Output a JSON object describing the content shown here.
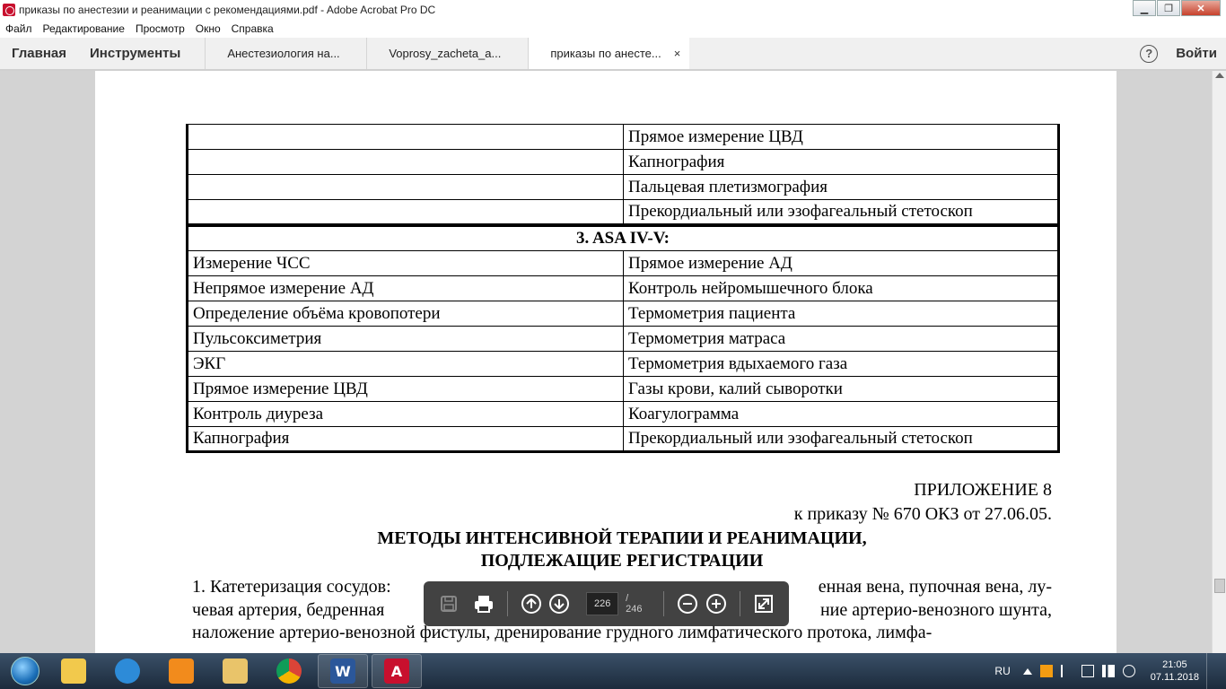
{
  "window": {
    "title": "приказы по анестезии и реанимации с рекомендациями.pdf - Adobe Acrobat Pro DC",
    "minimize": "▁",
    "maximize": "❐",
    "close": "✕"
  },
  "menu": [
    "Файл",
    "Редактирование",
    "Просмотр",
    "Окно",
    "Справка"
  ],
  "nav": {
    "home": "Главная",
    "tools": "Инструменты"
  },
  "tabs": [
    {
      "label": "Анестезиология на..."
    },
    {
      "label": "Voprosy_zacheta_a..."
    },
    {
      "label": "приказы по анесте...",
      "close": "×"
    }
  ],
  "header_right": {
    "help": "?",
    "signin": "Войти"
  },
  "table": {
    "top_rows": [
      [
        "",
        "Прямое измерение ЦВД"
      ],
      [
        "",
        "Капнография"
      ],
      [
        "",
        "Пальцевая плетизмография"
      ],
      [
        "",
        "Прекордиальный или эзофагеальный стетоскоп"
      ]
    ],
    "section_title": "3. ASA IV-V:",
    "rows": [
      [
        "Измерение ЧСС",
        "Прямое измерение АД"
      ],
      [
        "Непрямое измерение АД",
        "Контроль нейромышечного блока"
      ],
      [
        "Определение объёма кровопотери",
        "Термометрия пациента"
      ],
      [
        "Пульсоксиметрия",
        "Термометрия матраса"
      ],
      [
        "ЭКГ",
        "Термометрия вдыхаемого газа"
      ],
      [
        "Прямое измерение ЦВД",
        "Газы крови, калий сыворотки"
      ],
      [
        "Контроль диуреза",
        "Коагулограмма"
      ],
      [
        "Капнография",
        "Прекордиальный или эзофагеальный стетоскоп"
      ]
    ]
  },
  "appendix": {
    "line1": "ПРИЛОЖЕНИЕ 8",
    "line2": "к приказу № 670 ОКЗ от 27.06.05.",
    "title1": "МЕТОДЫ ИНТЕНСИВНОЙ ТЕРАПИИ И РЕАНИМАЦИИ,",
    "title2": "ПОДЛЕЖАЩИЕ РЕГИСТРАЦИИ",
    "p1a": "1. Катетеризация сосудов:",
    "p1b": "енная вена, пупочная вена, лу-",
    "p2a": "чевая артерия, бедренная",
    "p2b": "ние артерио-венозного шунта,",
    "p3": "наложение артерио-венозной фистулы, дренирование грудного лимфатического протока, лимфа-"
  },
  "floatbar": {
    "current_page": "226",
    "total_pages": "/ 246"
  },
  "taskbar": {
    "lang": "RU",
    "time": "21:05",
    "date": "07.11.2018",
    "word_label": "W",
    "acrobat_label": "A"
  },
  "colors": {
    "acrobat_red": "#c8102e",
    "page_bg": "#ffffff",
    "doc_bg": "#d3d3d3"
  }
}
